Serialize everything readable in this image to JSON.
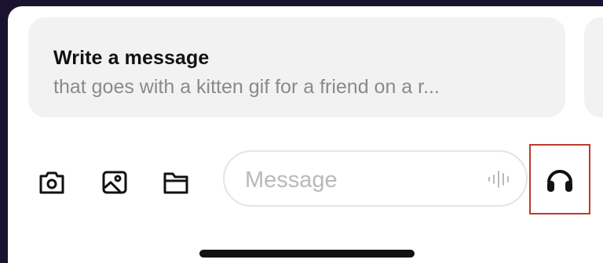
{
  "suggestion": {
    "title": "Write a message",
    "subtitle": "that goes with a kitten gif for a friend on a r..."
  },
  "composer": {
    "placeholder": "Message"
  },
  "icons": {
    "camera": "camera-icon",
    "photo": "photo-icon",
    "folder": "folder-icon",
    "voice_wave": "voice-waveform-icon",
    "voice_mode": "headphones-icon"
  },
  "colors": {
    "highlight_border": "#c0392b",
    "background_outer": "#1a1330",
    "card_background": "#f2f2f2"
  }
}
